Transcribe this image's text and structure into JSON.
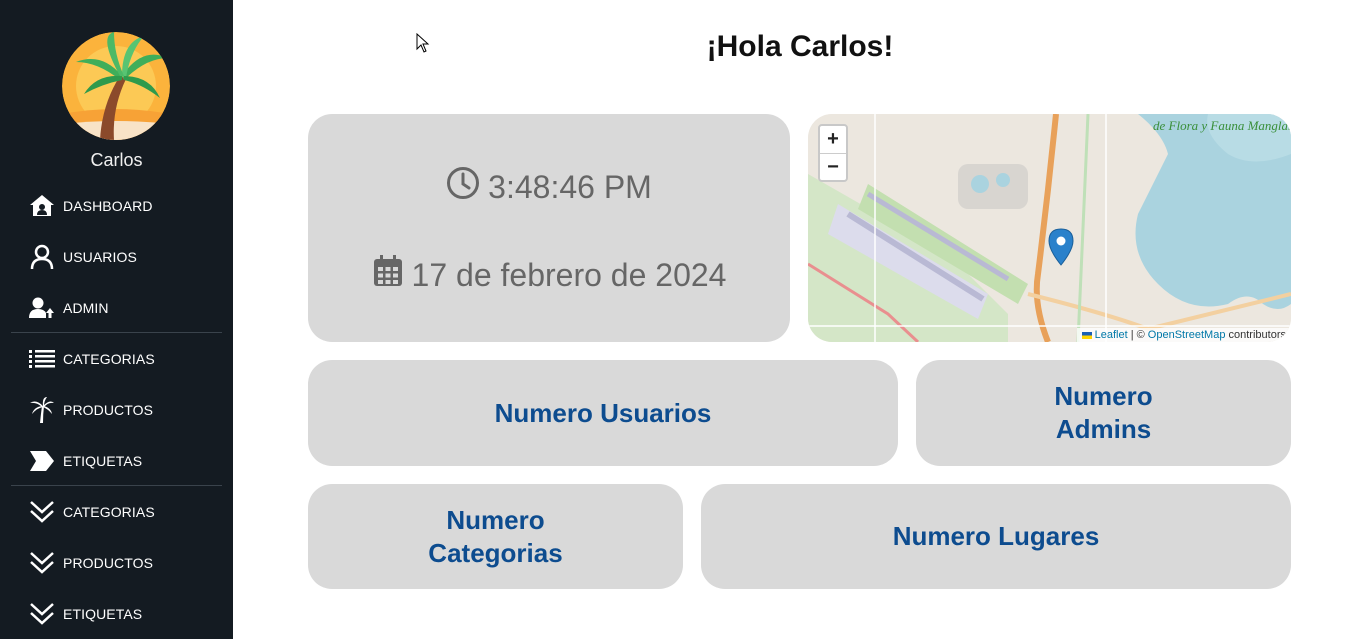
{
  "sidebar": {
    "username": "Carlos",
    "items": [
      {
        "label": "DASHBOARD",
        "icon": "house-user-icon"
      },
      {
        "label": "USUARIOS",
        "icon": "user-icon"
      },
      {
        "label": "ADMIN",
        "icon": "user-admin-icon"
      },
      {
        "label": "CATEGORIAS",
        "icon": "list-icon"
      },
      {
        "label": "PRODUCTOS",
        "icon": "palm-tree-icon"
      },
      {
        "label": "ETIQUETAS",
        "icon": "tag-icon"
      },
      {
        "label": "CATEGORIAS",
        "icon": "chevron-double-down-icon"
      },
      {
        "label": "PRODUCTOS",
        "icon": "chevron-double-down-icon"
      },
      {
        "label": "ETIQUETAS",
        "icon": "chevron-double-down-icon"
      }
    ]
  },
  "main": {
    "greeting": "¡Hola Carlos!",
    "clock": {
      "time": "3:48:46 PM",
      "date": "17 de febrero de 2024"
    },
    "map": {
      "zoom_in": "+",
      "zoom_out": "−",
      "label": "de Flora y Fauna Manglares de Nichupté",
      "attribution_leaflet": "Leaflet",
      "attribution_sep": "| ©",
      "attribution_osm": "OpenStreetMap",
      "attribution_suffix": "contributors"
    },
    "stats": {
      "usuarios": "Numero Usuarios",
      "admins_line1": "Numero",
      "admins_line2": "Admins",
      "categorias_line1": "Numero",
      "categorias_line2": "Categorias",
      "lugares": "Numero Lugares"
    }
  },
  "colors": {
    "sidebar_bg": "#141b22",
    "card_bg": "#d9d9d9",
    "stat_text": "#0d4c8f",
    "clock_text": "#666666"
  }
}
